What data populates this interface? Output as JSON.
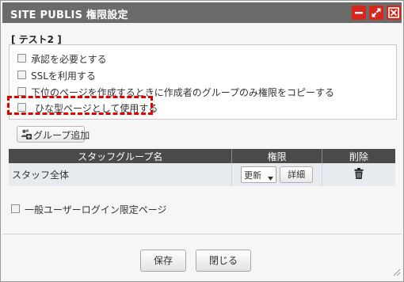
{
  "window": {
    "title": "SITE PUBLIS 権限設定",
    "icons": [
      "minimize-icon",
      "maximize-icon",
      "close-icon"
    ],
    "accent_color": "#d9261c",
    "titlebar_color": "#6b6b6b"
  },
  "section": {
    "label": "[ テスト2 ]"
  },
  "options": [
    {
      "label": "承認を必要とする",
      "checked": false
    },
    {
      "label": "SSLを利用する",
      "checked": false
    },
    {
      "label": "下位のページを作成するときに作成者のグループのみ権限をコピーする",
      "checked": false
    },
    {
      "label": "ひな型ページとして使用する",
      "checked": false,
      "highlighted": true
    }
  ],
  "add_group_button": {
    "label": "グループ追加",
    "icon": "group-add-icon"
  },
  "table": {
    "headers": [
      "スタッフグループ名",
      "権限",
      "削除"
    ],
    "rows": [
      {
        "name": "スタッフ全体",
        "permission": "更新",
        "detail_label": "詳細",
        "delete_icon": "trash-icon"
      }
    ],
    "header_color": "#4a4a4a",
    "row_color": "#e7ebf0"
  },
  "general": {
    "label": "一般ユーザーログイン限定ページ",
    "checked": false
  },
  "footer": {
    "save_label": "保存",
    "close_label": "閉じる"
  }
}
